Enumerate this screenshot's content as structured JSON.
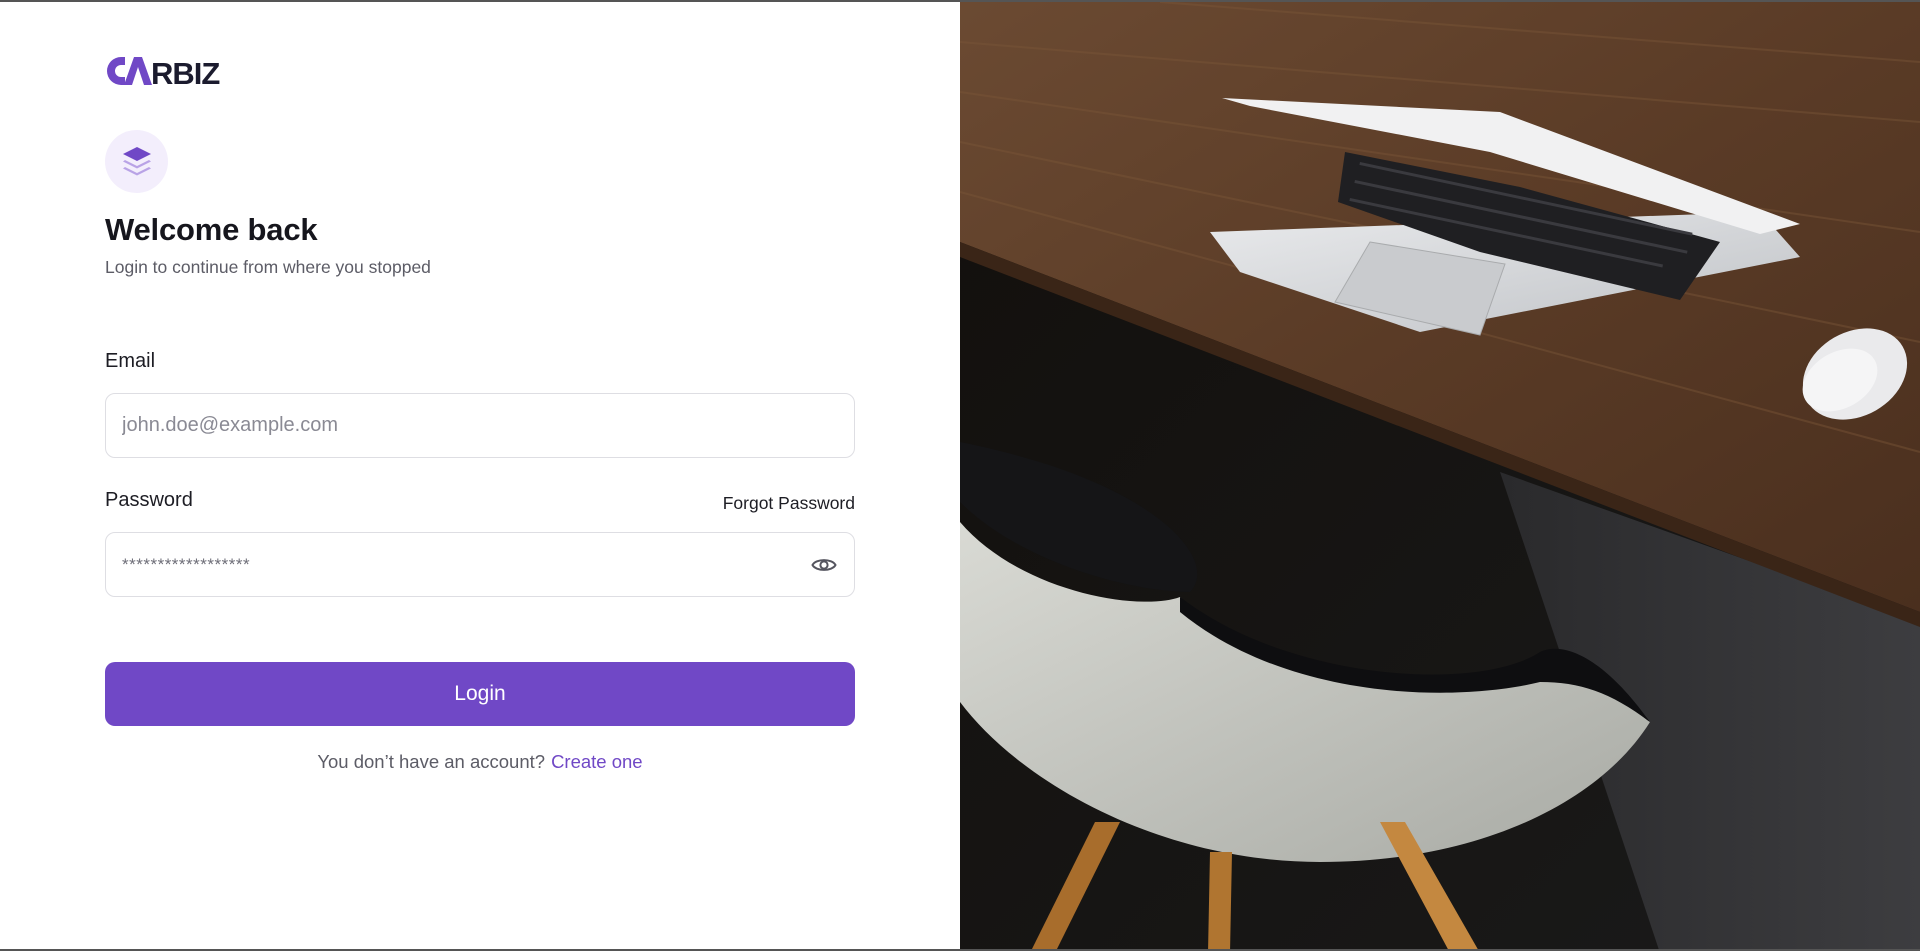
{
  "brand": {
    "name": "CARBIZ",
    "accent": "#7048c6",
    "dark": "#1b1b2e"
  },
  "feature_icon": "layers-icon",
  "header": {
    "title": "Welcome back",
    "subtitle": "Login to continue from where you stopped"
  },
  "form": {
    "email_label": "Email",
    "email_placeholder": "john.doe@example.com",
    "password_label": "Password",
    "forgot_password": "Forgot Password",
    "password_placeholder": "******************",
    "password_toggle_icon": "eye-icon",
    "login_label": "Login"
  },
  "signup": {
    "prompt": "You don’t have an account?",
    "link": "Create one"
  },
  "hero_image": {
    "subject": "laptop, mouse on wooden desk with white chair"
  }
}
